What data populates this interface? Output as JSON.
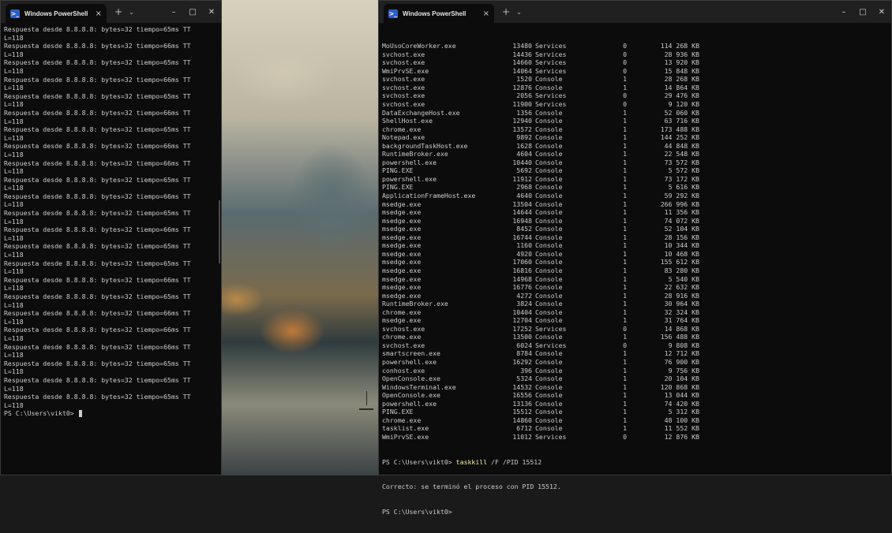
{
  "left_window": {
    "tab_title": "Windows PowerShell",
    "tab_close": "×",
    "new_tab": "+",
    "dropdown": "⌄",
    "controls": {
      "minimize": "–",
      "maximize": "□",
      "close": "✕"
    },
    "ping_lines": [
      "Respuesta desde 8.8.8.8: bytes=32 tiempo=65ms TT",
      "L=118",
      "Respuesta desde 8.8.8.8: bytes=32 tiempo=66ms TT",
      "L=118",
      "Respuesta desde 8.8.8.8: bytes=32 tiempo=65ms TT",
      "L=118",
      "Respuesta desde 8.8.8.8: bytes=32 tiempo=66ms TT",
      "L=118",
      "Respuesta desde 8.8.8.8: bytes=32 tiempo=65ms TT",
      "L=118",
      "Respuesta desde 8.8.8.8: bytes=32 tiempo=66ms TT",
      "L=118",
      "Respuesta desde 8.8.8.8: bytes=32 tiempo=65ms TT",
      "L=118",
      "Respuesta desde 8.8.8.8: bytes=32 tiempo=66ms TT",
      "L=118",
      "Respuesta desde 8.8.8.8: bytes=32 tiempo=66ms TT",
      "L=118",
      "Respuesta desde 8.8.8.8: bytes=32 tiempo=65ms TT",
      "L=118",
      "Respuesta desde 8.8.8.8: bytes=32 tiempo=66ms TT",
      "L=118",
      "Respuesta desde 8.8.8.8: bytes=32 tiempo=65ms TT",
      "L=118",
      "Respuesta desde 8.8.8.8: bytes=32 tiempo=66ms TT",
      "L=118",
      "Respuesta desde 8.8.8.8: bytes=32 tiempo=65ms TT",
      "L=118",
      "Respuesta desde 8.8.8.8: bytes=32 tiempo=65ms TT",
      "L=118",
      "Respuesta desde 8.8.8.8: bytes=32 tiempo=66ms TT",
      "L=118",
      "Respuesta desde 8.8.8.8: bytes=32 tiempo=65ms TT",
      "L=118",
      "Respuesta desde 8.8.8.8: bytes=32 tiempo=66ms TT",
      "L=118",
      "Respuesta desde 8.8.8.8: bytes=32 tiempo=66ms TT",
      "L=118",
      "Respuesta desde 8.8.8.8: bytes=32 tiempo=66ms TT",
      "L=118",
      "Respuesta desde 8.8.8.8: bytes=32 tiempo=65ms TT",
      "L=118",
      "Respuesta desde 8.8.8.8: bytes=32 tiempo=65ms TT",
      "L=118",
      "Respuesta desde 8.8.8.8: bytes=32 tiempo=65ms TT",
      "L=118"
    ],
    "prompt": "PS C:\\Users\\vikt0> "
  },
  "right_window": {
    "tab_title": "Windows PowerShell",
    "tab_close": "×",
    "new_tab": "+",
    "dropdown": "⌄",
    "controls": {
      "minimize": "–",
      "maximize": "□",
      "close": "✕"
    },
    "processes": [
      [
        "MoUsoCoreWorker.exe",
        "13480",
        "Services",
        "0",
        "114 268 KB"
      ],
      [
        "svchost.exe",
        "14436",
        "Services",
        "0",
        "28 936 KB"
      ],
      [
        "svchost.exe",
        "14660",
        "Services",
        "0",
        "13 920 KB"
      ],
      [
        "WmiPrvSE.exe",
        "14064",
        "Services",
        "0",
        "15 848 KB"
      ],
      [
        "svchost.exe",
        "1520",
        "Console",
        "1",
        "28 268 KB"
      ],
      [
        "svchost.exe",
        "12876",
        "Console",
        "1",
        "14 864 KB"
      ],
      [
        "svchost.exe",
        "2056",
        "Services",
        "0",
        "29 476 KB"
      ],
      [
        "svchost.exe",
        "11900",
        "Services",
        "0",
        "9 120 KB"
      ],
      [
        "DataExchangeHost.exe",
        "1356",
        "Console",
        "1",
        "52 060 KB"
      ],
      [
        "ShellHost.exe",
        "12940",
        "Console",
        "1",
        "63 716 KB"
      ],
      [
        "chrome.exe",
        "13572",
        "Console",
        "1",
        "173 488 KB"
      ],
      [
        "Notepad.exe",
        "9892",
        "Console",
        "1",
        "144 252 KB"
      ],
      [
        "backgroundTaskHost.exe",
        "1628",
        "Console",
        "1",
        "44 848 KB"
      ],
      [
        "RuntimeBroker.exe",
        "4604",
        "Console",
        "1",
        "22 548 KB"
      ],
      [
        "powershell.exe",
        "10440",
        "Console",
        "1",
        "73 572 KB"
      ],
      [
        "PING.EXE",
        "5692",
        "Console",
        "1",
        "5 572 KB"
      ],
      [
        "powershell.exe",
        "11912",
        "Console",
        "1",
        "73 172 KB"
      ],
      [
        "PING.EXE",
        "2968",
        "Console",
        "1",
        "5 616 KB"
      ],
      [
        "ApplicationFrameHost.exe",
        "4640",
        "Console",
        "1",
        "59 292 KB"
      ],
      [
        "msedge.exe",
        "13504",
        "Console",
        "1",
        "266 996 KB"
      ],
      [
        "msedge.exe",
        "14644",
        "Console",
        "1",
        "11 356 KB"
      ],
      [
        "msedge.exe",
        "16948",
        "Console",
        "1",
        "74 072 KB"
      ],
      [
        "msedge.exe",
        "8452",
        "Console",
        "1",
        "52 104 KB"
      ],
      [
        "msedge.exe",
        "16744",
        "Console",
        "1",
        "28 156 KB"
      ],
      [
        "msedge.exe",
        "1160",
        "Console",
        "1",
        "10 344 KB"
      ],
      [
        "msedge.exe",
        "4920",
        "Console",
        "1",
        "10 468 KB"
      ],
      [
        "msedge.exe",
        "17060",
        "Console",
        "1",
        "155 612 KB"
      ],
      [
        "msedge.exe",
        "16816",
        "Console",
        "1",
        "83 280 KB"
      ],
      [
        "msedge.exe",
        "14968",
        "Console",
        "1",
        "5 540 KB"
      ],
      [
        "msedge.exe",
        "16776",
        "Console",
        "1",
        "22 632 KB"
      ],
      [
        "msedge.exe",
        "4272",
        "Console",
        "1",
        "28 916 KB"
      ],
      [
        "RuntimeBroker.exe",
        "3824",
        "Console",
        "1",
        "30 964 KB"
      ],
      [
        "chrome.exe",
        "10404",
        "Console",
        "1",
        "32 324 KB"
      ],
      [
        "msedge.exe",
        "12704",
        "Console",
        "1",
        "31 764 KB"
      ],
      [
        "svchost.exe",
        "17252",
        "Services",
        "0",
        "14 868 KB"
      ],
      [
        "chrome.exe",
        "13500",
        "Console",
        "1",
        "156 488 KB"
      ],
      [
        "svchost.exe",
        "6024",
        "Services",
        "0",
        "9 808 KB"
      ],
      [
        "smartscreen.exe",
        "8784",
        "Console",
        "1",
        "12 712 KB"
      ],
      [
        "powershell.exe",
        "16292",
        "Console",
        "1",
        "76 900 KB"
      ],
      [
        "conhost.exe",
        "396",
        "Console",
        "1",
        "9 756 KB"
      ],
      [
        "OpenConsole.exe",
        "5324",
        "Console",
        "1",
        "20 104 KB"
      ],
      [
        "WindowsTerminal.exe",
        "14532",
        "Console",
        "1",
        "120 868 KB"
      ],
      [
        "OpenConsole.exe",
        "16556",
        "Console",
        "1",
        "13 044 KB"
      ],
      [
        "powershell.exe",
        "13136",
        "Console",
        "1",
        "74 420 KB"
      ],
      [
        "PING.EXE",
        "15512",
        "Console",
        "1",
        "5 312 KB"
      ],
      [
        "chrome.exe",
        "14860",
        "Console",
        "1",
        "48 100 KB"
      ],
      [
        "tasklist.exe",
        "6712",
        "Console",
        "1",
        "11 552 KB"
      ],
      [
        "WmiPrvSE.exe",
        "11012",
        "Services",
        "0",
        "12 876 KB"
      ]
    ],
    "cmd_prompt": "PS C:\\Users\\vikt0> ",
    "cmd_keyword": "taskkill",
    "cmd_args": " /F /PID 15512",
    "result": "Correcto: se terminó el proceso con PID 15512.",
    "final_prompt": "PS C:\\Users\\vikt0>"
  }
}
